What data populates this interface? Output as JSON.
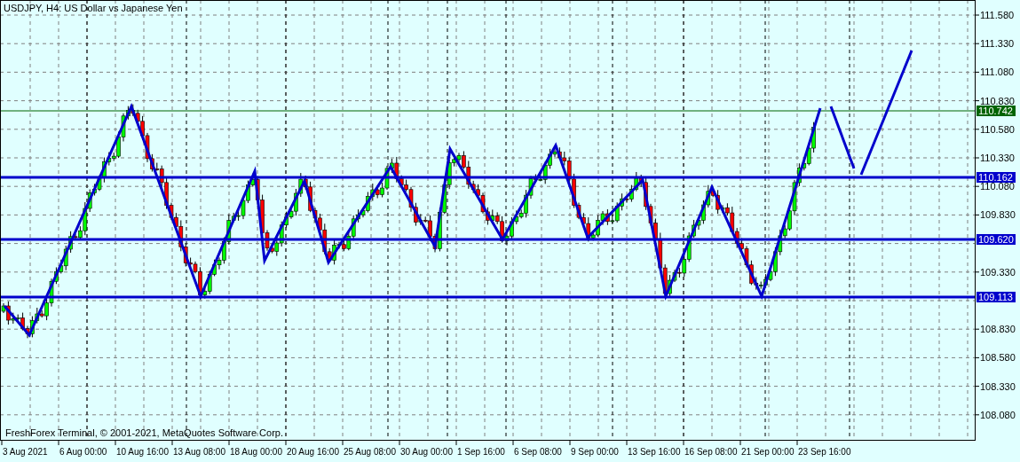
{
  "title": "USDJPY, H4:  US Dollar vs Japanese Yen",
  "price_axis": [
    "111.580",
    "111.330",
    "111.080",
    "110.830",
    "110.580",
    "110.330",
    "110.080",
    "109.830",
    "109.330",
    "108.830",
    "108.580",
    "108.330",
    "108.080"
  ],
  "price_tags": [
    {
      "label": "110.742",
      "color": "#006400",
      "kind": "thin"
    },
    {
      "label": "110.162",
      "color": "#0000cc",
      "kind": "thick"
    },
    {
      "label": "109.620",
      "color": "#0000cc",
      "kind": "thick"
    },
    {
      "label": "109.113",
      "color": "#0000cc",
      "kind": "thick"
    }
  ],
  "time_axis": [
    "3 Aug 2021",
    "6 Aug 00:00",
    "10 Aug 16:00",
    "13 Aug 08:00",
    "18 Aug 00:00",
    "20 Aug 16:00",
    "25 Aug 08:00",
    "30 Aug 00:00",
    "1 Sep 16:00",
    "6 Sep 08:00",
    "9 Sep 00:00",
    "13 Sep 16:00",
    "16 Sep 08:00",
    "21 Sep 00:00",
    "23 Sep 16:00"
  ],
  "copyright": "FreshForex Terminal, © 2001-2021, MetaQuotes Software Corp."
}
